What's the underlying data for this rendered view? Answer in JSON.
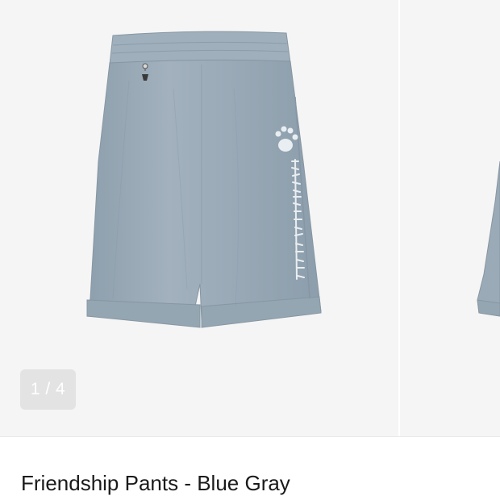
{
  "gallery": {
    "counter": "1 / 4",
    "colors": {
      "background": "#f5f5f5",
      "shorts": "#9aaab7",
      "counter_bg": "#e3e3e3"
    }
  },
  "product": {
    "title": "Friendship Pants - Blue Gray"
  }
}
